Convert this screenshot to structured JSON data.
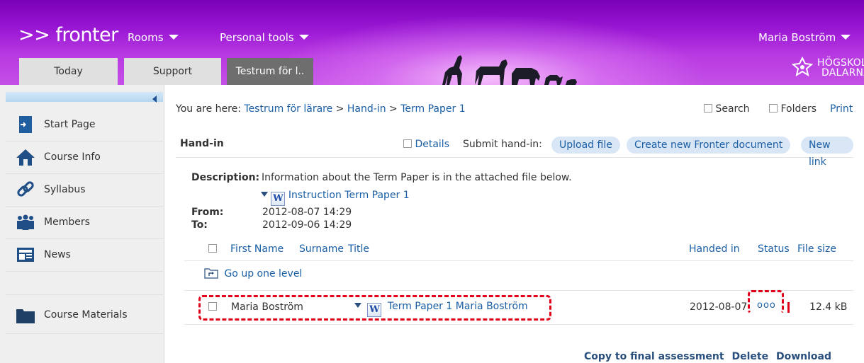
{
  "header": {
    "logo_text": ">> fronter",
    "nav": {
      "rooms": "Rooms",
      "personal_tools": "Personal tools",
      "user": "Maria Boström"
    },
    "tabs": [
      "Today",
      "Support",
      "Testrum för l.."
    ],
    "school": {
      "line1": "HÖGSKOLAN",
      "line2": "DALARNA"
    }
  },
  "sidebar": {
    "items": [
      {
        "label": "Start Page",
        "icon": "start-page-icon"
      },
      {
        "label": "Course Info",
        "icon": "home-icon"
      },
      {
        "label": "Syllabus",
        "icon": "link-icon"
      },
      {
        "label": "Members",
        "icon": "members-icon"
      },
      {
        "label": "News",
        "icon": "news-icon"
      },
      {
        "label": "Course Materials",
        "icon": "folder-icon"
      }
    ]
  },
  "breadcrumb": {
    "prefix": "You are here:",
    "items": [
      "Testrum för lärare",
      "Hand-in",
      "Term Paper 1"
    ],
    "separator": ">"
  },
  "toolbar_right": {
    "search": "Search",
    "folders": "Folders",
    "print": "Print"
  },
  "panel": {
    "title": "Hand-in",
    "details": "Details",
    "submit_label": "Submit hand-in:",
    "upload": "Upload file",
    "create": "Create new Fronter document",
    "new_link": "New link",
    "description_label": "Description:",
    "description": "Information about the Term Paper is in the attached file below.",
    "attachment": "Instruction Term Paper 1",
    "from_label": "From:",
    "from": "2012-08-07 14:29",
    "to_label": "To:",
    "to": "2012-09-06 14:29",
    "columns": {
      "first_name": "First Name",
      "surname": "Surname",
      "title": "Title",
      "handed_in": "Handed in",
      "status": "Status",
      "file_size": "File size"
    },
    "go_up": "Go up one level",
    "rows": [
      {
        "name": "Maria Boström",
        "title": "Term Paper 1 Maria Boström",
        "handed_in": "2012-08-07",
        "status": "ooo",
        "file_size": "12.4 kB"
      }
    ],
    "actions": {
      "copy": "Copy to final assessment",
      "delete": "Delete",
      "download": "Download"
    }
  },
  "colors": {
    "accent_purple": "#9a18d4",
    "link_blue": "#1a5fa6",
    "highlight_red": "#e3001b"
  }
}
